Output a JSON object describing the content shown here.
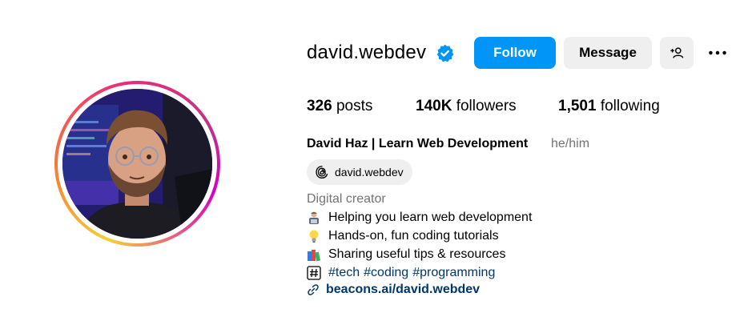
{
  "profile": {
    "username": "david.webdev",
    "verified": true,
    "buttons": {
      "follow": "Follow",
      "message": "Message"
    },
    "stats": {
      "posts_count": "326",
      "posts_label": "posts",
      "followers_count": "140K",
      "followers_label": "followers",
      "following_count": "1,501",
      "following_label": "following"
    },
    "full_name": "David Haz | Learn Web Development",
    "pronouns": "he/him",
    "threads_handle": "david.webdev",
    "category": "Digital creator",
    "bio": {
      "line1": "Helping you learn web development",
      "line2": "Hands-on, fun coding tutorials",
      "line3": "Sharing useful tips & resources",
      "hashtags": [
        "#tech",
        "#coding",
        "#programming"
      ]
    },
    "link": "beacons.ai/david.webdev"
  },
  "colors": {
    "follow_button": "#0095f6",
    "secondary_button": "#efefef",
    "link": "#00376b",
    "muted_text": "#737373",
    "verified_badge": "#0095f6"
  },
  "icons": {
    "verified": "verified-badge-icon",
    "suggest": "person-plus-icon",
    "more": "more-options-icon",
    "threads": "threads-icon",
    "link": "link-icon"
  }
}
